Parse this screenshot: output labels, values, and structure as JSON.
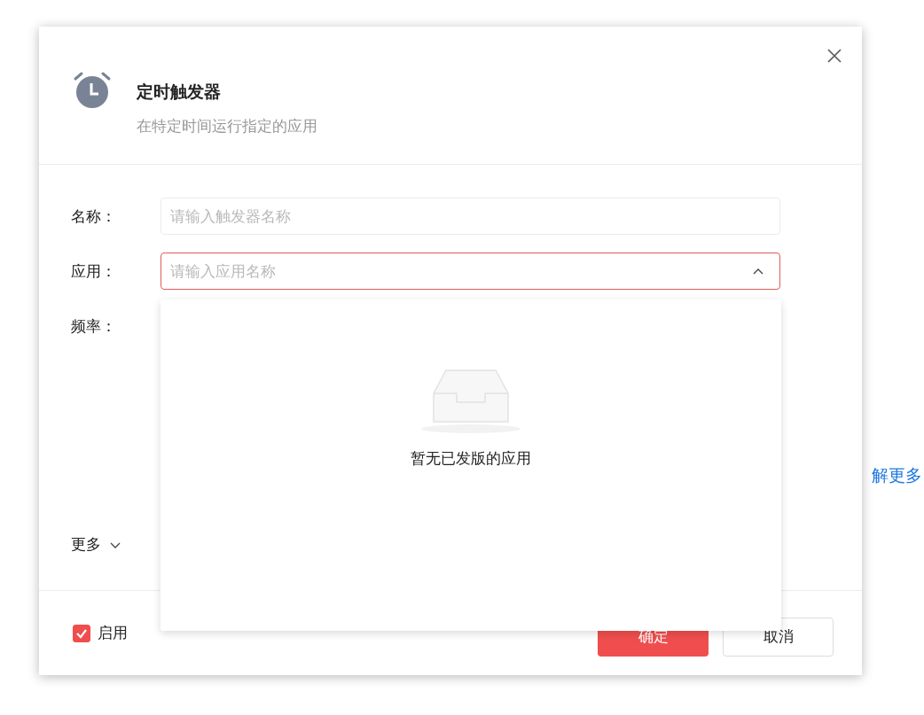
{
  "background": {
    "link": "解更多"
  },
  "dialog": {
    "title": "定时触发器",
    "subtitle": "在特定时间运行指定的应用",
    "fields": [
      {
        "label": "名称：",
        "kind": "input",
        "placeholder": "请输入触发器名称",
        "focused": false
      },
      {
        "label": "应用：",
        "kind": "select",
        "placeholder": "请输入应用名称",
        "focused": true,
        "expanded": true
      },
      {
        "label": "频率：",
        "kind": "none"
      }
    ],
    "more": {
      "label": "更多",
      "expanded": false
    },
    "enabled": {
      "label": "启用",
      "checked": true
    },
    "buttons": [
      {
        "label": "确定",
        "kind": "primary"
      },
      {
        "label": "取消",
        "kind": "default"
      }
    ]
  },
  "dropdown": {
    "empty_text": "暂无已发版的应用"
  }
}
